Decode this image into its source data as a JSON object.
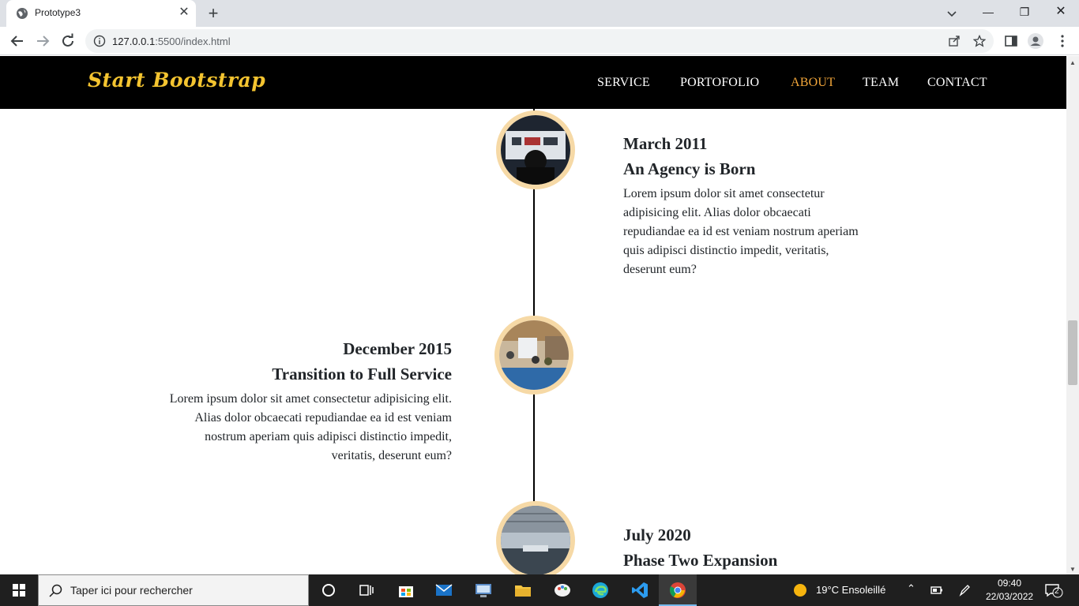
{
  "browser": {
    "tab_title": "Prototype3",
    "url_host": "127.0.0.1",
    "url_path": ":5500/index.html"
  },
  "site": {
    "brand": "Start Bootstrap",
    "nav": [
      {
        "label": "SERVICE"
      },
      {
        "label": "PORTOFOLIO"
      },
      {
        "label": "ABOUT",
        "active": true
      },
      {
        "label": "TEAM"
      },
      {
        "label": "CONTACT"
      }
    ],
    "accent_color": "#f2a63a",
    "brand_color": "#f4c430"
  },
  "timeline": [
    {
      "date": "March 2011",
      "title": "An Agency is Born",
      "body": "Lorem ipsum dolor sit amet consectetur adipisicing elit. Alias dolor obcaecati repudiandae ea id est veniam nostrum aperiam quis adipisci distinctio impedit, veritatis, deserunt eum?",
      "side": "right"
    },
    {
      "date": "December 2015",
      "title": "Transition to Full Service",
      "body": "Lorem ipsum dolor sit amet consectetur adipisicing elit. Alias dolor obcaecati repudiandae ea id est veniam nostrum aperiam quis adipisci distinctio impedit, veritatis, deserunt eum?",
      "side": "left"
    },
    {
      "date": "July 2020",
      "title": "Phase Two Expansion",
      "side": "right"
    }
  ],
  "taskbar": {
    "search_placeholder": "Taper ici pour rechercher",
    "weather": "19°C  Ensoleillé",
    "time": "09:40",
    "date": "22/03/2022",
    "notifications": "2"
  }
}
